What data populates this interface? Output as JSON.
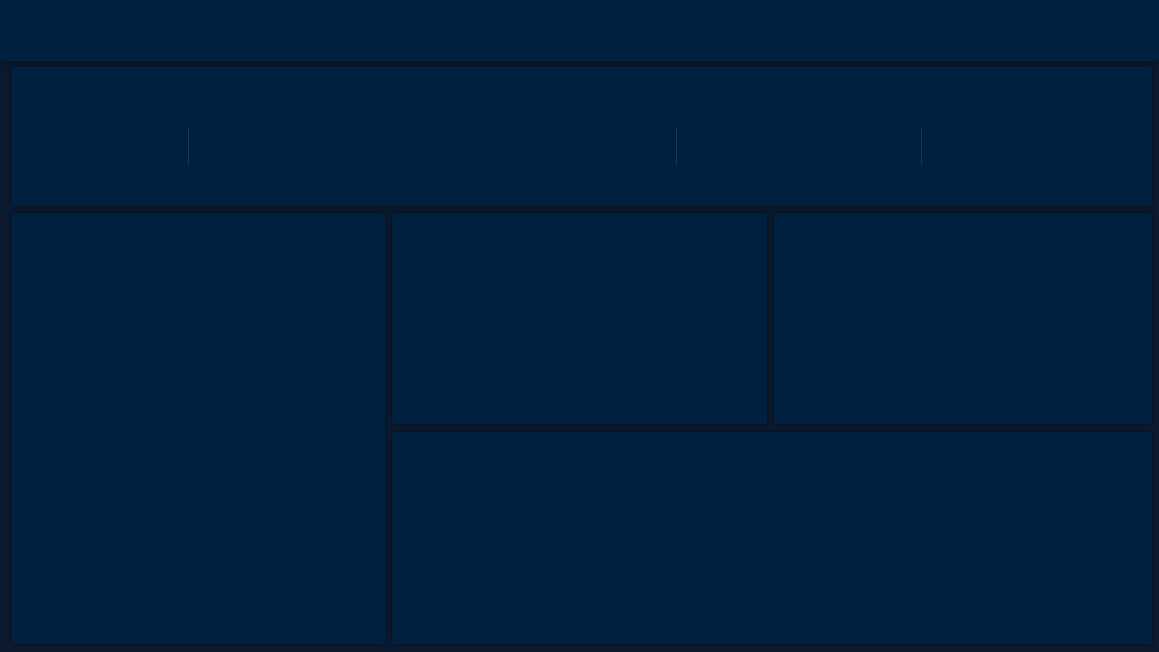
{
  "app": {
    "title": ""
  },
  "header": {
    "title": ""
  },
  "stats": {
    "items": []
  },
  "panels": {
    "left": {
      "title": ""
    },
    "middle": {
      "title": ""
    },
    "right": {
      "title": ""
    },
    "bottom": {
      "title": ""
    }
  },
  "colors": {
    "background": "#0b1a2e",
    "panel": "#00203f",
    "divider": "#1a3556"
  }
}
